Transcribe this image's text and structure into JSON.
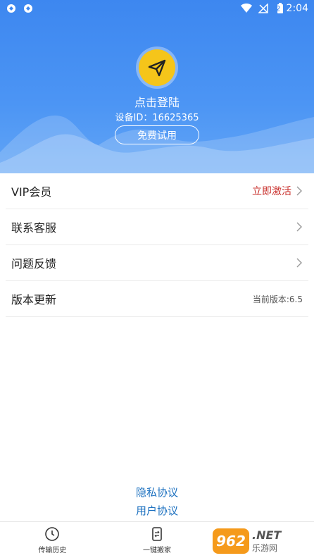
{
  "status_bar": {
    "time": "2:04",
    "battery": "2",
    "icons": [
      "sync-icon",
      "sync-icon",
      "wifi-icon",
      "no-signal-icon",
      "battery-icon"
    ]
  },
  "header": {
    "login_label": "点击登陆",
    "device_id": "设备ID：16625365",
    "trial_button": "免费试用",
    "avatar_icon": "paper-plane-icon"
  },
  "menu": {
    "vip": {
      "label": "VIP会员",
      "value": "立即激活"
    },
    "support": {
      "label": "联系客服"
    },
    "feedback": {
      "label": "问题反馈"
    },
    "update": {
      "label": "版本更新",
      "value": "当前版本:6.5"
    }
  },
  "links": {
    "privacy": "隐私协议",
    "user_agreement": "用户协议"
  },
  "tabs": [
    {
      "label": "传输历史",
      "icon": "clock-icon"
    },
    {
      "label": "一键搬家",
      "icon": "phone-transfer-icon"
    }
  ],
  "watermark": {
    "logo": "962",
    "net": ".NET",
    "cn": "乐游网"
  },
  "colors": {
    "header_blue": "#3d87f0",
    "accent_red": "#c9302c",
    "link_blue": "#1a6fbf",
    "avatar_yellow": "#f5c51a"
  }
}
